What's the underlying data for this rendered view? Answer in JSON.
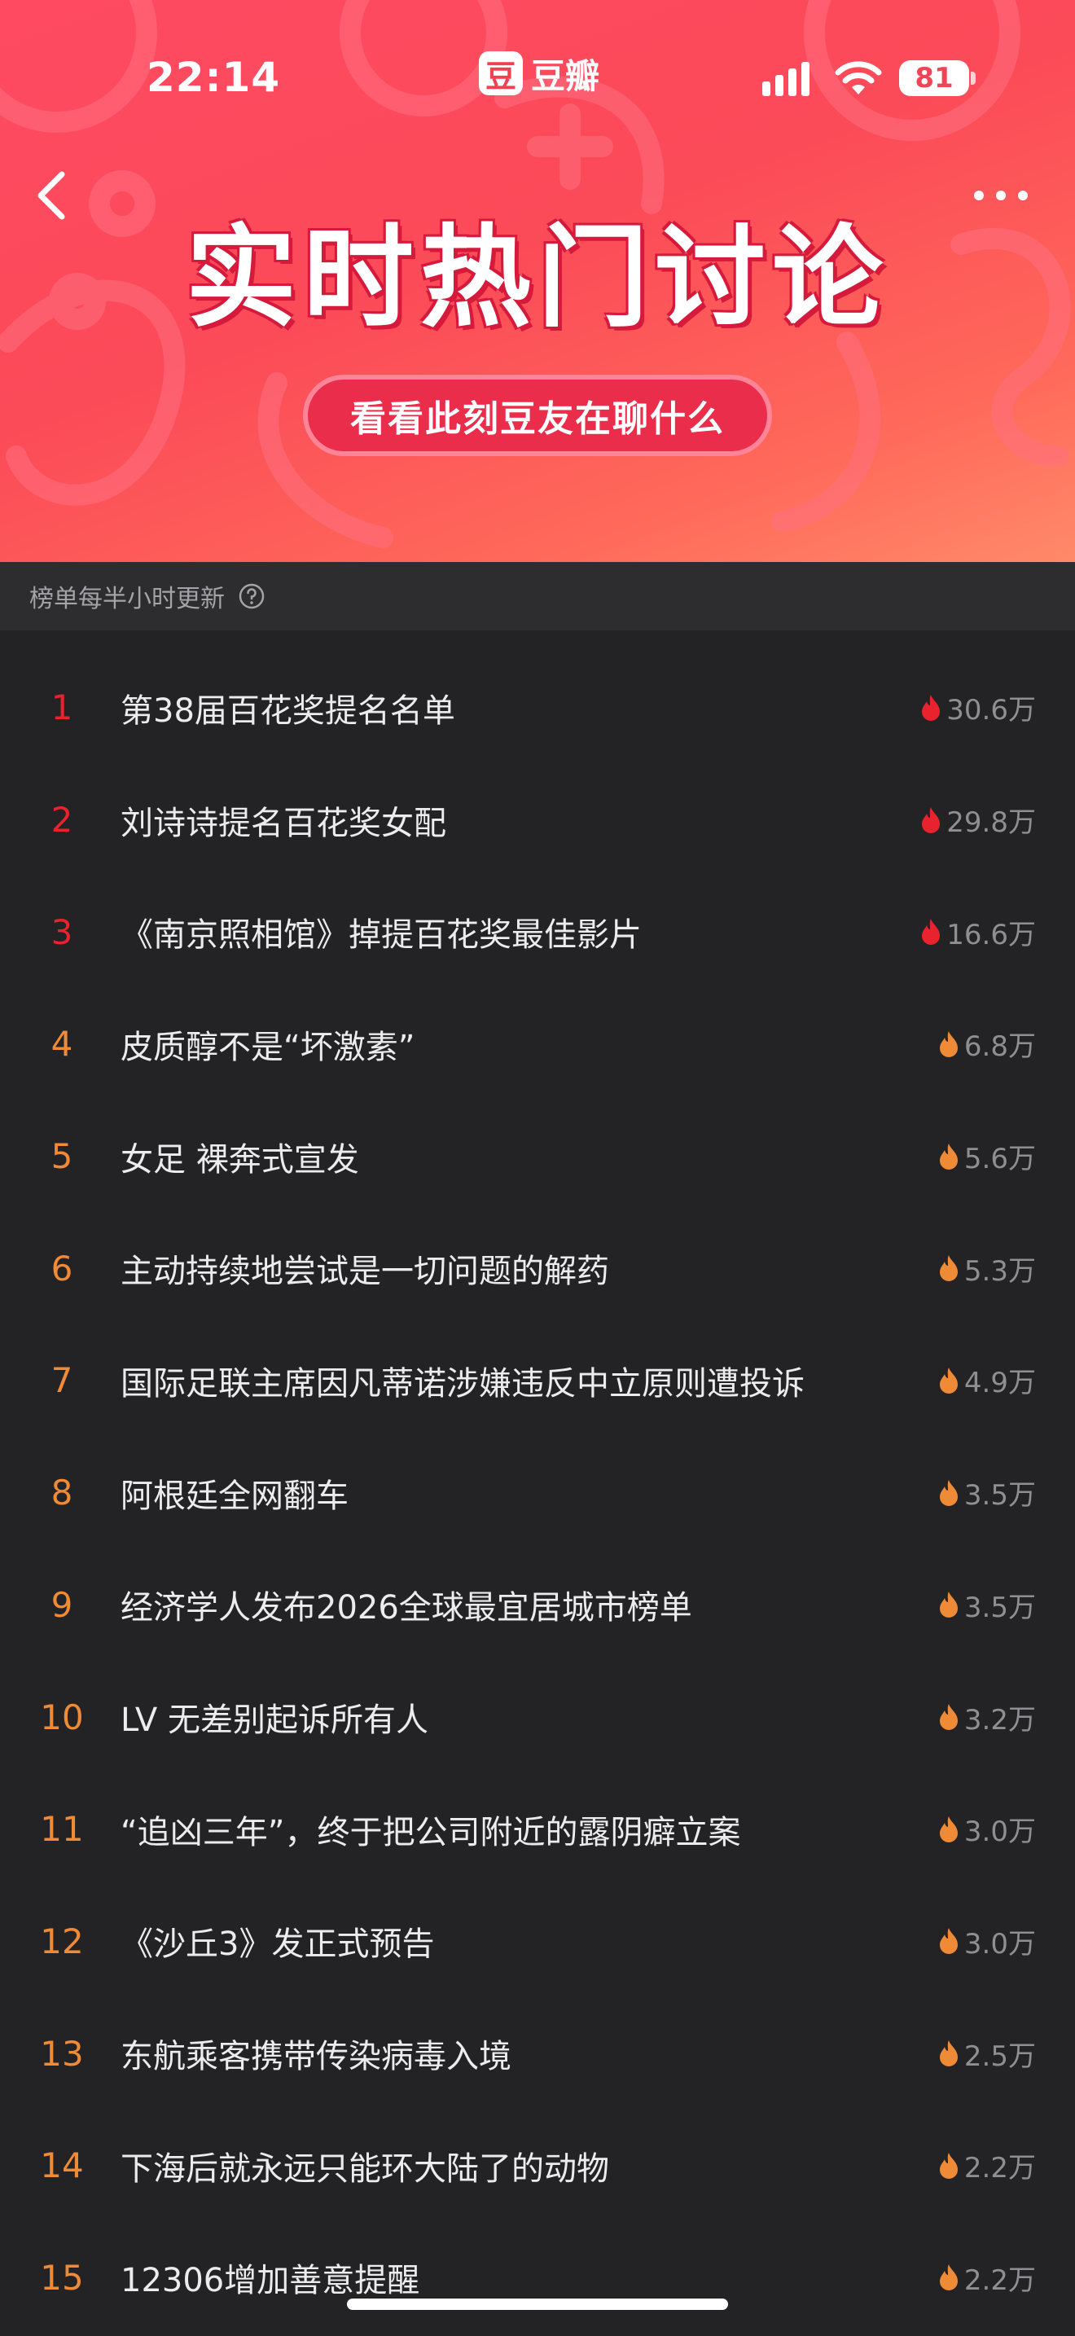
{
  "status_bar": {
    "time": "22:14",
    "brand_logo": "豆",
    "brand_name": "豆瓣",
    "battery": "81"
  },
  "nav": {
    "back_icon": "chevron-left-icon",
    "more_icon": "more-icon"
  },
  "banner": {
    "title": "实时热门讨论",
    "subtitle": "看看此刻豆友在聊什么"
  },
  "update_note": "榜单每半小时更新",
  "colors": {
    "header_red": "#fb4a58",
    "rank_top": "#e8232d",
    "rank_other": "#ef8a37",
    "flame_hot": "#e8232d",
    "flame_warm": "#ef8a37",
    "background": "#232325"
  },
  "topics": [
    {
      "rank": "1",
      "title": "第38届百花奖提名名单",
      "heat": "30.6万",
      "hot": true
    },
    {
      "rank": "2",
      "title": "刘诗诗提名百花奖女配",
      "heat": "29.8万",
      "hot": true
    },
    {
      "rank": "3",
      "title": "《南京照相馆》掉提百花奖最佳影片",
      "heat": "16.6万",
      "hot": true
    },
    {
      "rank": "4",
      "title": "皮质醇不是“坏激素”",
      "heat": "6.8万",
      "hot": false
    },
    {
      "rank": "5",
      "title": "女足 裸奔式宣发",
      "heat": "5.6万",
      "hot": false
    },
    {
      "rank": "6",
      "title": "主动持续地尝试是一切问题的解药",
      "heat": "5.3万",
      "hot": false
    },
    {
      "rank": "7",
      "title": "国际足联主席因凡蒂诺涉嫌违反中立原则遭投诉",
      "heat": "4.9万",
      "hot": false
    },
    {
      "rank": "8",
      "title": "阿根廷全网翻车",
      "heat": "3.5万",
      "hot": false
    },
    {
      "rank": "9",
      "title": "经济学人发布2026全球最宜居城市榜单",
      "heat": "3.5万",
      "hot": false
    },
    {
      "rank": "10",
      "title": "LV 无差别起诉所有人",
      "heat": "3.2万",
      "hot": false
    },
    {
      "rank": "11",
      "title": "“追凶三年”，终于把公司附近的露阴癖立案",
      "heat": "3.0万",
      "hot": false
    },
    {
      "rank": "12",
      "title": "《沙丘3》发正式预告",
      "heat": "3.0万",
      "hot": false
    },
    {
      "rank": "13",
      "title": "东航乘客携带传染病毒入境",
      "heat": "2.5万",
      "hot": false
    },
    {
      "rank": "14",
      "title": "下海后就永远只能环大陆了的动物",
      "heat": "2.2万",
      "hot": false
    },
    {
      "rank": "15",
      "title": "12306增加善意提醒",
      "heat": "2.2万",
      "hot": false
    }
  ]
}
